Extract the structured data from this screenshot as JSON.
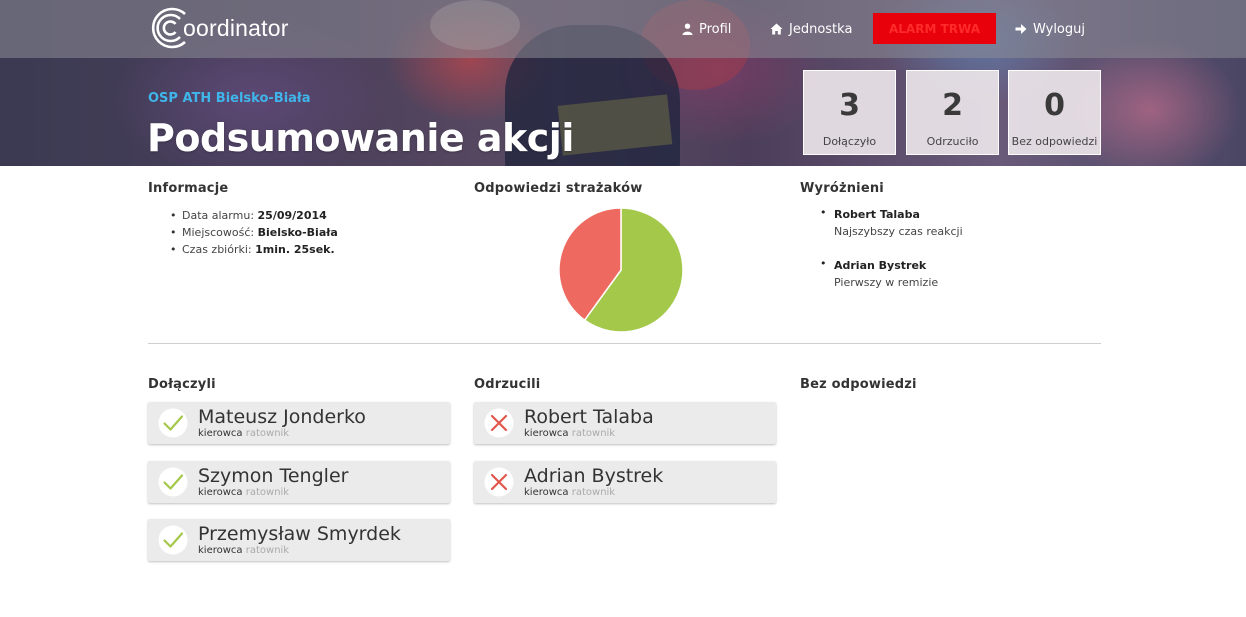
{
  "header": {
    "logo_text": "oordinator",
    "nav": {
      "profil": "Profil",
      "jednostka": "Jednostka",
      "alarm": "ALARM TRWA",
      "wyloguj": "Wyloguj"
    },
    "unit_name": "OSP ATH Bielsko-Biała",
    "page_title": "Podsumowanie akcji",
    "stats": {
      "joined": {
        "value": "3",
        "label": "Dołączyło"
      },
      "rejected": {
        "value": "2",
        "label": "Odrzuciło"
      },
      "no_answer": {
        "value": "0",
        "label": "Bez odpowiedzi"
      }
    }
  },
  "info": {
    "title": "Informacje",
    "items": [
      {
        "label": "Data alarmu: ",
        "value": "25/09/2014"
      },
      {
        "label": "Miejscowość: ",
        "value": "Bielsko-Biała"
      },
      {
        "label": "Czas zbiórki: ",
        "value": "1min. 25sek."
      }
    ]
  },
  "responses": {
    "title": "Odpowiedzi strażaków"
  },
  "chart_data": {
    "type": "pie",
    "title": "Odpowiedzi strażaków",
    "categories": [
      "Dołączyło",
      "Odrzuciło",
      "Bez odpowiedzi"
    ],
    "values": [
      3,
      2,
      0
    ],
    "colors": [
      "#a3c84a",
      "#ee6a61",
      "#cccccc"
    ]
  },
  "distinguished": {
    "title": "Wyróżnieni",
    "items": [
      {
        "name": "Robert Talaba",
        "desc": "Najszybszy czas reakcji"
      },
      {
        "name": "Adrian Bystrek",
        "desc": "Pierwszy w remizie"
      }
    ]
  },
  "columns": {
    "joined": {
      "title": "Dołączyli",
      "people": [
        {
          "name": "Mateusz Jonderko",
          "role_main": "kierowca",
          "role_secondary": "ratownik"
        },
        {
          "name": "Szymon Tengler",
          "role_main": "kierowca",
          "role_secondary": "ratownik"
        },
        {
          "name": "Przemysław Smyrdek",
          "role_main": "kierowca",
          "role_secondary": "ratownik"
        }
      ]
    },
    "rejected": {
      "title": "Odrzucili",
      "people": [
        {
          "name": "Robert Talaba",
          "role_main": "kierowca",
          "role_secondary": "ratownik"
        },
        {
          "name": "Adrian Bystrek",
          "role_main": "kierowca",
          "role_secondary": "ratownik"
        }
      ]
    },
    "no_answer": {
      "title": "Bez odpowiedzi",
      "people": []
    }
  },
  "colors": {
    "accent_blue": "#3fb5ea",
    "alarm_red": "#e8000b",
    "joined_green": "#a3c84a",
    "rejected_red": "#ee6a61"
  }
}
